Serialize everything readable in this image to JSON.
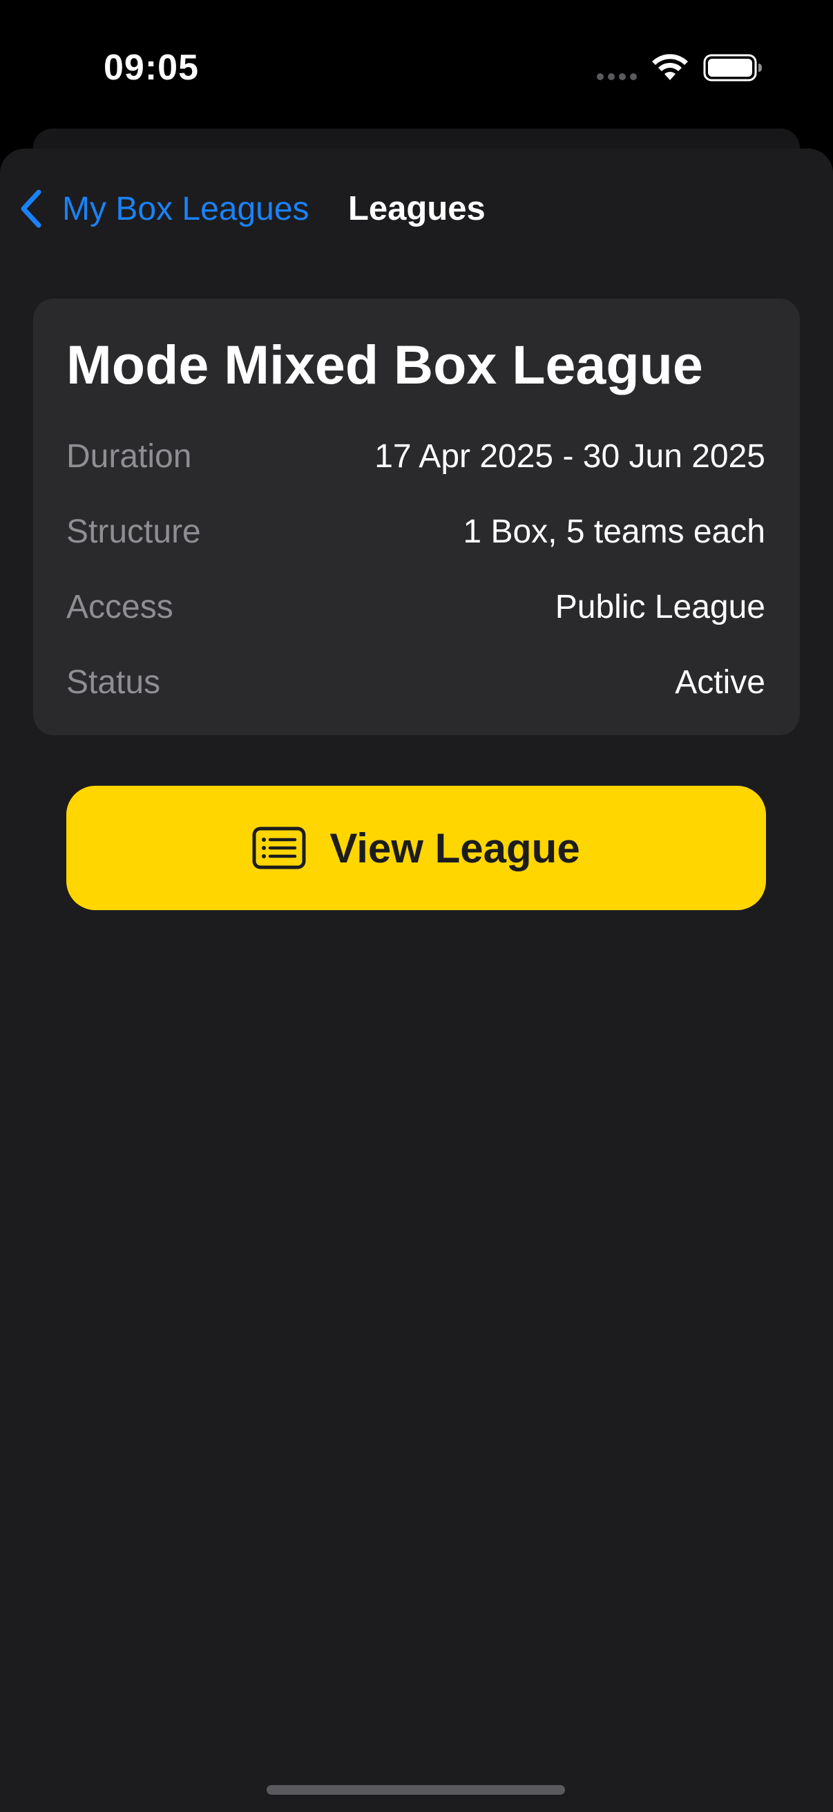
{
  "status_bar": {
    "time": "09:05"
  },
  "nav": {
    "back_label": "My Box Leagues",
    "title": "Leagues"
  },
  "league": {
    "name": "Mode Mixed Box League",
    "details": [
      {
        "label": "Duration",
        "value": "17 Apr 2025 - 30 Jun 2025"
      },
      {
        "label": "Structure",
        "value": "1 Box, 5 teams each"
      },
      {
        "label": "Access",
        "value": "Public League"
      },
      {
        "label": "Status",
        "value": "Active"
      }
    ]
  },
  "actions": {
    "view_league_label": "View League",
    "view_league_icon": "list-icon"
  },
  "colors": {
    "background": "#1c1c1e",
    "card": "#2a2a2d",
    "accent_link": "#1a82f7",
    "primary_button": "#ffd600",
    "secondary_text": "#8e8e93"
  }
}
